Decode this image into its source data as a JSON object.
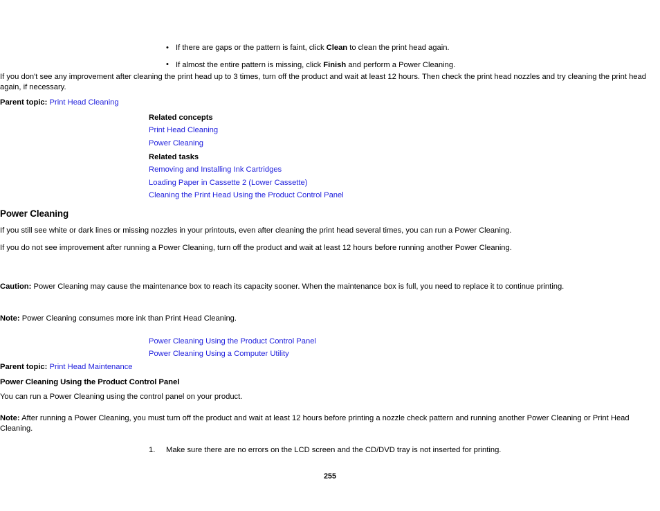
{
  "document": {
    "page_number": "255",
    "link_color": "#2222dd",
    "text_color": "#000000",
    "background_color": "#ffffff"
  },
  "bullets": [
    {
      "pre": "If there are gaps or the pattern is faint, click ",
      "bold": "Clean",
      "post": " to clean the print head again."
    },
    {
      "pre": "If almost the entire pattern is missing, click ",
      "bold": "Finish",
      "post": " and perform a Power Cleaning."
    }
  ],
  "intro_paragraph": "If you don't see any improvement after cleaning the print head up to 3 times, turn off the product and wait at least 12 hours. Then check the print head nozzles and try cleaning the print head again, if necessary.",
  "parent_topic_1": {
    "label": "Parent topic:",
    "link": "Print Head Cleaning"
  },
  "related_concepts": {
    "heading": "Related concepts",
    "links": [
      "Print Head Cleaning",
      "Power Cleaning"
    ]
  },
  "related_tasks": {
    "heading": "Related tasks",
    "links": [
      "Removing and Installing Ink Cartridges",
      "Loading Paper in Cassette 2 (Lower Cassette)",
      "Cleaning the Print Head Using the Product Control Panel"
    ]
  },
  "power_cleaning": {
    "title": "Power Cleaning",
    "paragraph_1": "If you still see white or dark lines or missing nozzles in your printouts, even after cleaning the print head several times, you can run a Power Cleaning.",
    "paragraph_2": "If you do not see improvement after running a Power Cleaning, turn off the product and wait at least 12 hours before running another Power Cleaning.",
    "caution": {
      "label": "Caution:",
      "text": " Power Cleaning may cause the maintenance box to reach its capacity sooner. When the maintenance box is full, you need to replace it to continue printing."
    },
    "note": {
      "label": "Note:",
      "text": " Power Cleaning consumes more ink than Print Head Cleaning."
    },
    "child_links": [
      "Power Cleaning Using the Product Control Panel",
      "Power Cleaning Using a Computer Utility"
    ],
    "parent_topic": {
      "label": "Parent topic:",
      "link": "Print Head Maintenance"
    }
  },
  "power_cleaning_control_panel": {
    "title": "Power Cleaning Using the Product Control Panel",
    "paragraph_1": "You can run a Power Cleaning using the control panel on your product.",
    "note": {
      "label": "Note:",
      "text": " After running a Power Cleaning, you must turn off the product and wait at least 12 hours before printing a nozzle check pattern and running another Power Cleaning or Print Head Cleaning."
    },
    "steps": [
      {
        "number": "1.",
        "text": "Make sure there are no errors on the LCD screen and the CD/DVD tray is not inserted for printing."
      }
    ]
  }
}
